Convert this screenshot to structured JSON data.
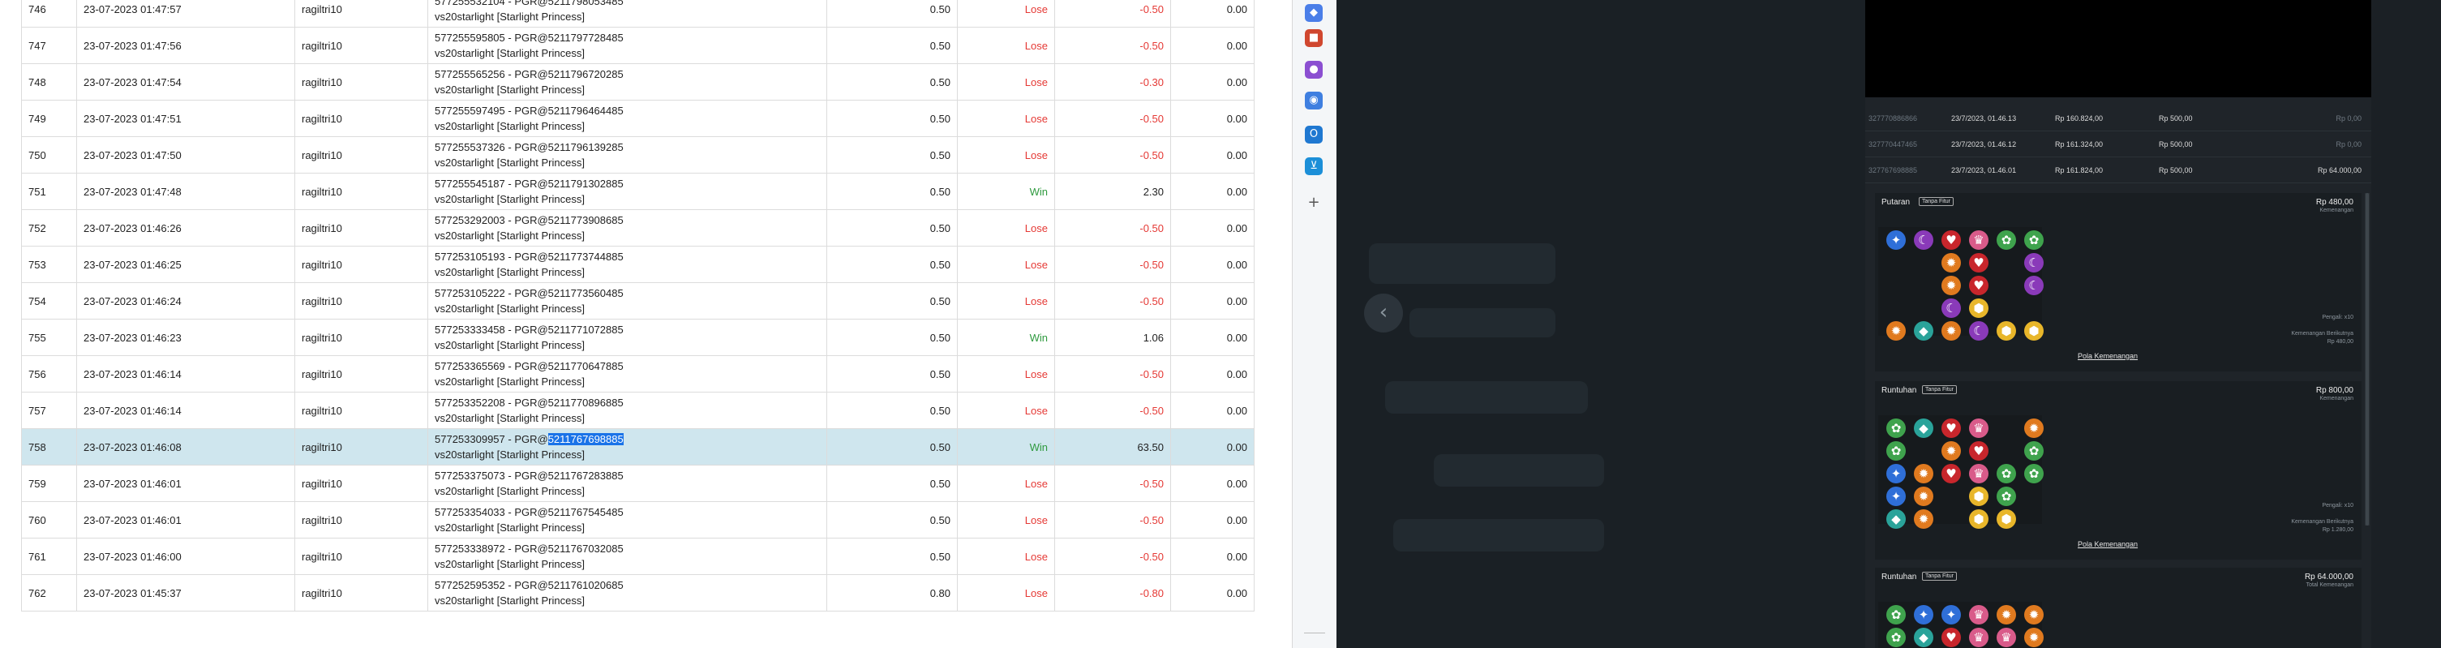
{
  "bet_table": {
    "rows": [
      {
        "no": "746",
        "time": "23-07-2023 01:47:57",
        "user": "ragiltri10",
        "code": "577255532104 - PGR@5211798053485",
        "game": "vs20starlight [Starlight Princess]",
        "bet": "0.50",
        "result": "Lose",
        "win": "-0.50",
        "balance": "0.00"
      },
      {
        "no": "747",
        "time": "23-07-2023 01:47:56",
        "user": "ragiltri10",
        "code": "577255595805 - PGR@5211797728485",
        "game": "vs20starlight [Starlight Princess]",
        "bet": "0.50",
        "result": "Lose",
        "win": "-0.50",
        "balance": "0.00"
      },
      {
        "no": "748",
        "time": "23-07-2023 01:47:54",
        "user": "ragiltri10",
        "code": "577255565256 - PGR@5211796720285",
        "game": "vs20starlight [Starlight Princess]",
        "bet": "0.50",
        "result": "Lose",
        "win": "-0.30",
        "balance": "0.00"
      },
      {
        "no": "749",
        "time": "23-07-2023 01:47:51",
        "user": "ragiltri10",
        "code": "577255597495 - PGR@5211796464485",
        "game": "vs20starlight [Starlight Princess]",
        "bet": "0.50",
        "result": "Lose",
        "win": "-0.50",
        "balance": "0.00"
      },
      {
        "no": "750",
        "time": "23-07-2023 01:47:50",
        "user": "ragiltri10",
        "code": "577255537326 - PGR@5211796139285",
        "game": "vs20starlight [Starlight Princess]",
        "bet": "0.50",
        "result": "Lose",
        "win": "-0.50",
        "balance": "0.00"
      },
      {
        "no": "751",
        "time": "23-07-2023 01:47:48",
        "user": "ragiltri10",
        "code": "577255545187 - PGR@5211791302885",
        "game": "vs20starlight [Starlight Princess]",
        "bet": "0.50",
        "result": "Win",
        "win": "2.30",
        "balance": "0.00"
      },
      {
        "no": "752",
        "time": "23-07-2023 01:46:26",
        "user": "ragiltri10",
        "code": "577253292003 - PGR@5211773908685",
        "game": "vs20starlight [Starlight Princess]",
        "bet": "0.50",
        "result": "Lose",
        "win": "-0.50",
        "balance": "0.00"
      },
      {
        "no": "753",
        "time": "23-07-2023 01:46:25",
        "user": "ragiltri10",
        "code": "577253105193 - PGR@5211773744885",
        "game": "vs20starlight [Starlight Princess]",
        "bet": "0.50",
        "result": "Lose",
        "win": "-0.50",
        "balance": "0.00"
      },
      {
        "no": "754",
        "time": "23-07-2023 01:46:24",
        "user": "ragiltri10",
        "code": "577253105222 - PGR@5211773560485",
        "game": "vs20starlight [Starlight Princess]",
        "bet": "0.50",
        "result": "Lose",
        "win": "-0.50",
        "balance": "0.00"
      },
      {
        "no": "755",
        "time": "23-07-2023 01:46:23",
        "user": "ragiltri10",
        "code": "577253333458 - PGR@5211771072885",
        "game": "vs20starlight [Starlight Princess]",
        "bet": "0.50",
        "result": "Win",
        "win": "1.06",
        "balance": "0.00"
      },
      {
        "no": "756",
        "time": "23-07-2023 01:46:14",
        "user": "ragiltri10",
        "code": "577253365569 - PGR@5211770647885",
        "game": "vs20starlight [Starlight Princess]",
        "bet": "0.50",
        "result": "Lose",
        "win": "-0.50",
        "balance": "0.00"
      },
      {
        "no": "757",
        "time": "23-07-2023 01:46:14",
        "user": "ragiltri10",
        "code": "577253352208 - PGR@5211770896885",
        "game": "vs20starlight [Starlight Princess]",
        "bet": "0.50",
        "result": "Lose",
        "win": "-0.50",
        "balance": "0.00"
      },
      {
        "no": "758",
        "time": "23-07-2023 01:46:08",
        "user": "ragiltri10",
        "code": "577253309957 - PGR@5211767698885",
        "code_prefix": "577253309957 - PGR@",
        "code_selected": "5211767698885",
        "game": "vs20starlight [Starlight Princess]",
        "bet": "0.50",
        "result": "Win",
        "win": "63.50",
        "balance": "0.00"
      },
      {
        "no": "759",
        "time": "23-07-2023 01:46:01",
        "user": "ragiltri10",
        "code": "577253375073 - PGR@5211767283885",
        "game": "vs20starlight [Starlight Princess]",
        "bet": "0.50",
        "result": "Lose",
        "win": "-0.50",
        "balance": "0.00"
      },
      {
        "no": "760",
        "time": "23-07-2023 01:46:01",
        "user": "ragiltri10",
        "code": "577253354033 - PGR@5211767545485",
        "game": "vs20starlight [Starlight Princess]",
        "bet": "0.50",
        "result": "Lose",
        "win": "-0.50",
        "balance": "0.00"
      },
      {
        "no": "761",
        "time": "23-07-2023 01:46:00",
        "user": "ragiltri10",
        "code": "577253338972 - PGR@5211767032085",
        "game": "vs20starlight [Starlight Princess]",
        "bet": "0.50",
        "result": "Lose",
        "win": "-0.50",
        "balance": "0.00"
      },
      {
        "no": "762",
        "time": "23-07-2023 01:45:37",
        "user": "ragiltri10",
        "code": "577252595352 - PGR@5211761020685",
        "game": "vs20starlight [Starlight Princess]",
        "bet": "0.80",
        "result": "Lose",
        "win": "-0.80",
        "balance": "0.00"
      }
    ],
    "selected_row": "758"
  },
  "edge_sidebar": {
    "icons": [
      {
        "name": "tag-icon",
        "glyph": "◆",
        "color": "#4a7ee8"
      },
      {
        "name": "toolbox-icon",
        "glyph": "■",
        "color": "#d0472f"
      },
      {
        "name": "person-icon",
        "glyph": "●",
        "color": "#8b4fd1"
      },
      {
        "name": "copilot-icon",
        "glyph": "◉",
        "color": "#3f7fe0"
      },
      {
        "name": "outlook-icon",
        "glyph": "O",
        "color": "#1f78d1"
      },
      {
        "name": "shopping-cart-icon",
        "glyph": "⊻",
        "color": "#1c8fd8"
      },
      {
        "name": "plus-icon",
        "glyph": "+",
        "color": "#555555"
      }
    ]
  },
  "history_panel": {
    "transactions": [
      {
        "id": "327770886866",
        "date": "23/7/2023, 01.46.13",
        "saldo": "Rp 160.824,00",
        "bet": "Rp 500,00",
        "win": "Rp 0,00"
      },
      {
        "id": "327770447465",
        "date": "23/7/2023, 01.46.12",
        "saldo": "Rp 161.324,00",
        "bet": "Rp 500,00",
        "win": "Rp 0,00"
      },
      {
        "id": "327767698885",
        "date": "23/7/2023, 01.46.01",
        "saldo": "Rp 161.824,00",
        "bet": "Rp 500,00",
        "win": "Rp 64.000,00"
      }
    ],
    "rounds": [
      {
        "title": "Putaran",
        "badge": "Tanpa Fitur",
        "amount": "Rp 480,00",
        "amount_label": "Kemenangan",
        "pengali": "Pengali: x10",
        "kemenangan_sebelum": "Kemenangan Berikutnya",
        "kemenangan_value": "Rp 480,00",
        "link": "Pola Kemenangan"
      },
      {
        "title": "Runtuhan",
        "badge": "Tanpa Fitur",
        "amount": "Rp 800,00",
        "amount_label": "Kemenangan",
        "pengali": "Pengali: x10",
        "kemenangan_sebelum": "Kemenangan Berikutnya",
        "kemenangan_value": "Rp 1.280,00",
        "link": "Pola Kemenangan"
      },
      {
        "title": "Runtuhan",
        "badge": "Tanpa Fitur",
        "amount": "Rp 64.000,00",
        "amount_label": "Total Kemenangan"
      }
    ]
  }
}
